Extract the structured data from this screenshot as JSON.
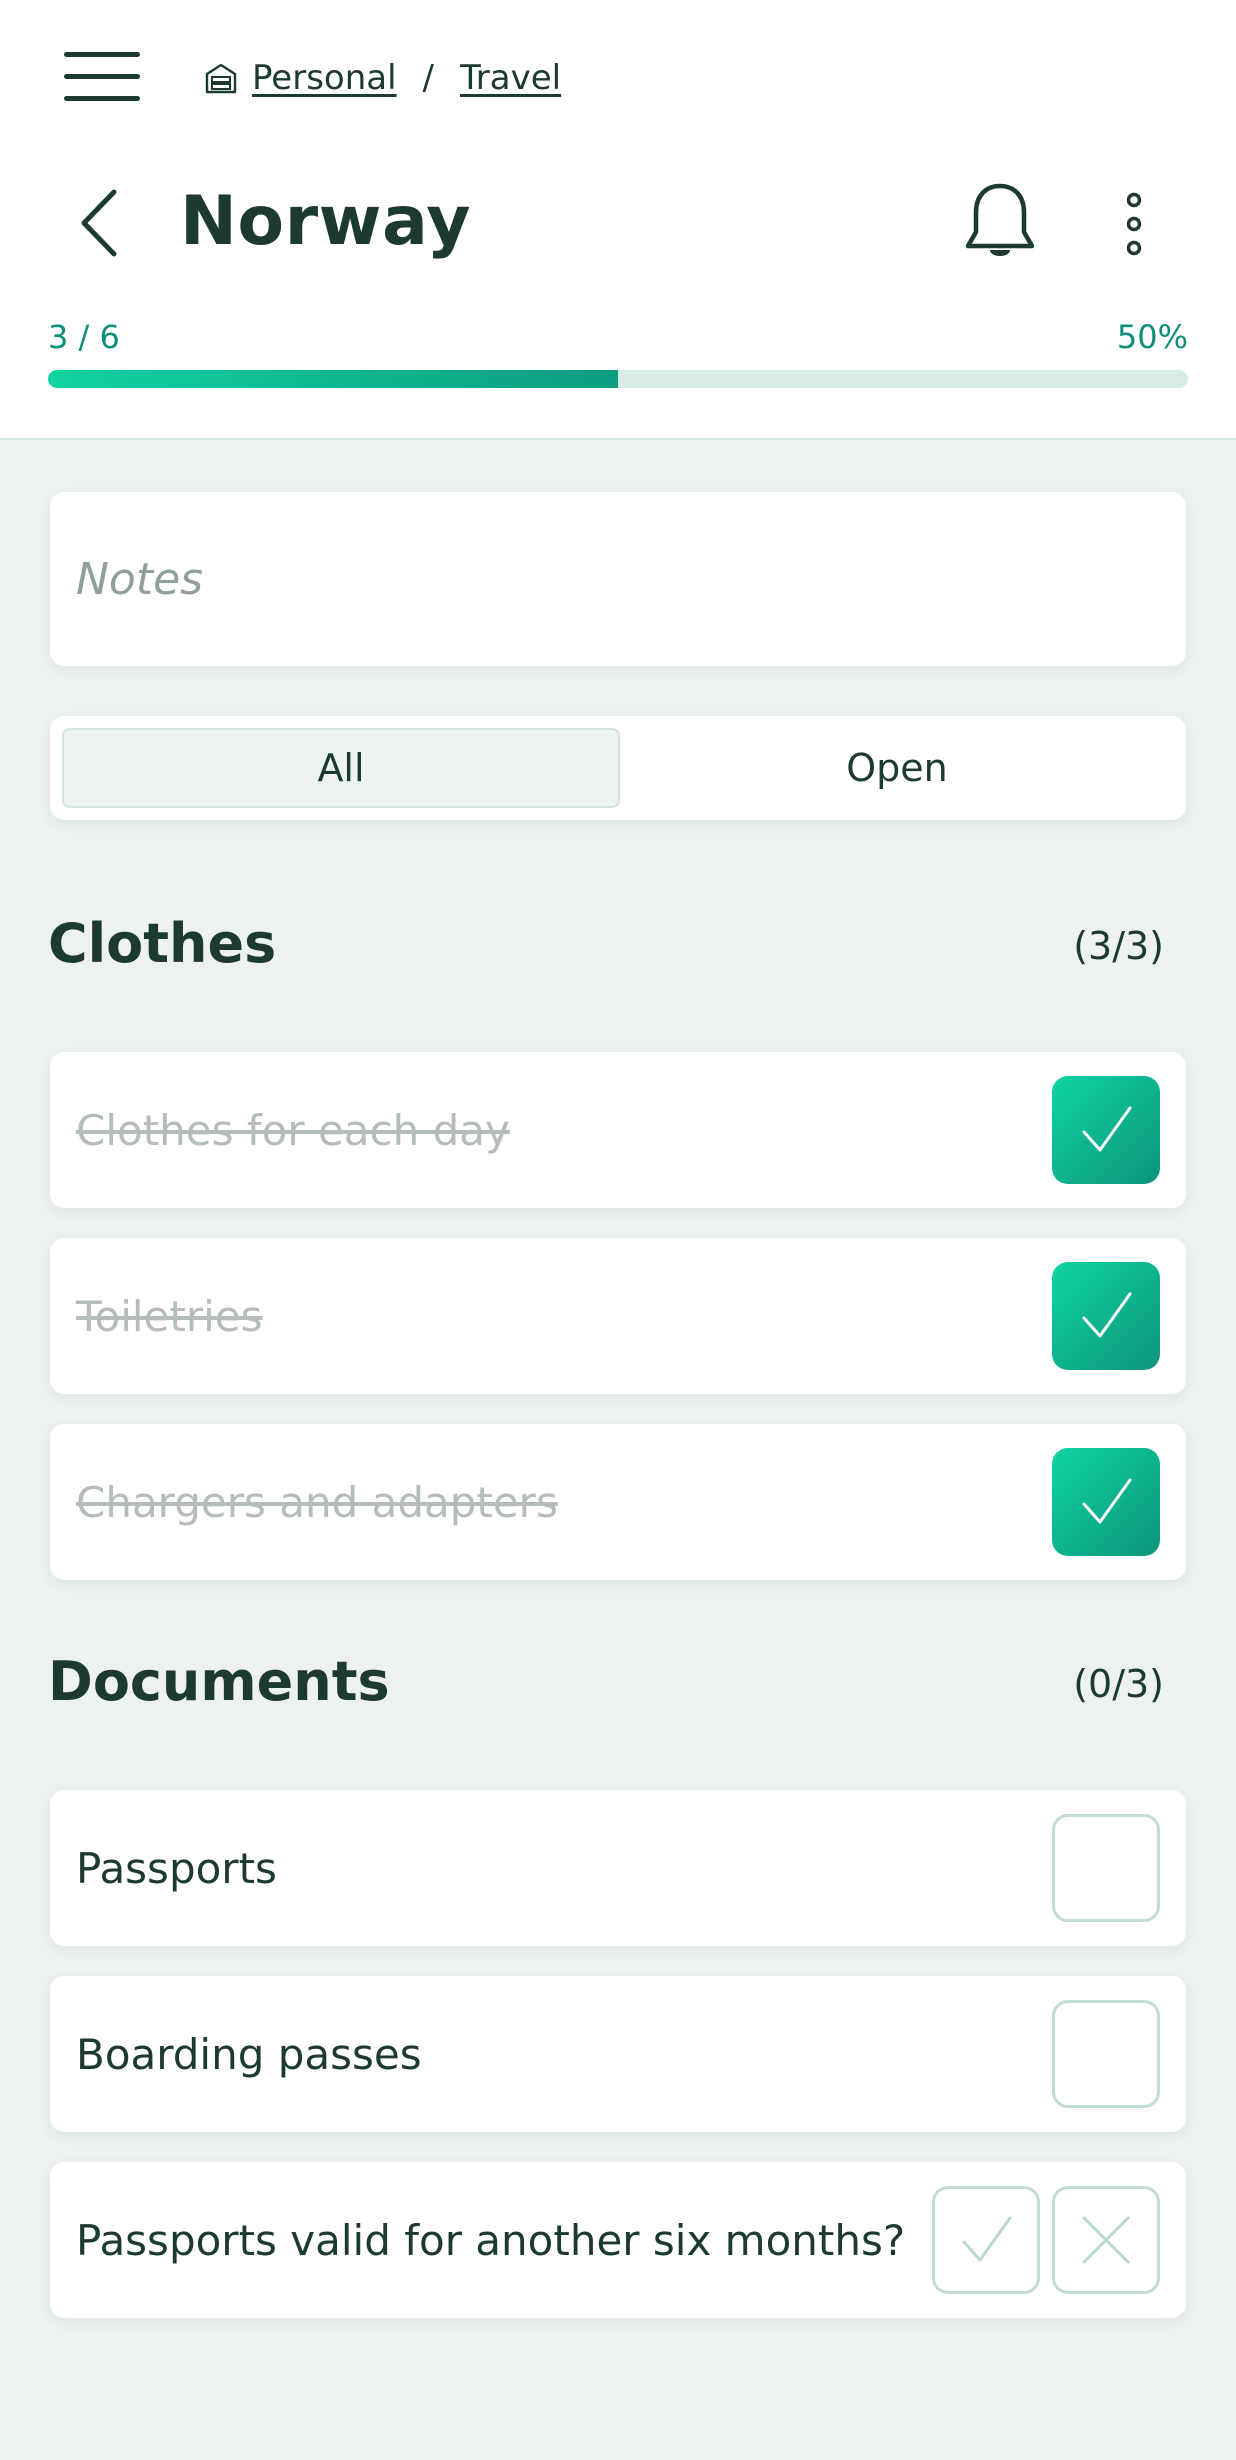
{
  "breadcrumb": {
    "items": [
      "Personal",
      "Travel"
    ],
    "separator": "/"
  },
  "page": {
    "title": "Norway"
  },
  "progress": {
    "count_label": "3 / 6",
    "percent_label": "50%",
    "fraction": 0.5
  },
  "notes": {
    "placeholder": "Notes",
    "value": ""
  },
  "filter": {
    "options": [
      "All",
      "Open"
    ],
    "selected": "All"
  },
  "sections": [
    {
      "title": "Clothes",
      "count": "(3/3)",
      "items": [
        {
          "label": "Clothes for each day",
          "checked": true
        },
        {
          "label": "Toiletries",
          "checked": true
        },
        {
          "label": "Chargers and adapters",
          "checked": true
        }
      ]
    },
    {
      "title": "Documents",
      "count": "(0/3)",
      "items": [
        {
          "label": "Passports",
          "checked": false
        },
        {
          "label": "Boarding passes",
          "checked": false
        },
        {
          "label": "Passports valid for another six months?",
          "type": "yes-no"
        }
      ]
    }
  ],
  "colors": {
    "accent": "#0e8f79",
    "accent_gradient_start": "#12d3a0",
    "accent_gradient_end": "#0b9c82",
    "text": "#1d3a2e",
    "background": "#edf2f1",
    "done_text": "#b5bdba"
  },
  "icons": {
    "menu": "hamburger-icon",
    "home": "folder-home-icon",
    "back": "chevron-left-icon",
    "notifications": "bell-icon",
    "more": "more-vertical-icon",
    "check": "check-icon",
    "cross": "close-icon"
  }
}
